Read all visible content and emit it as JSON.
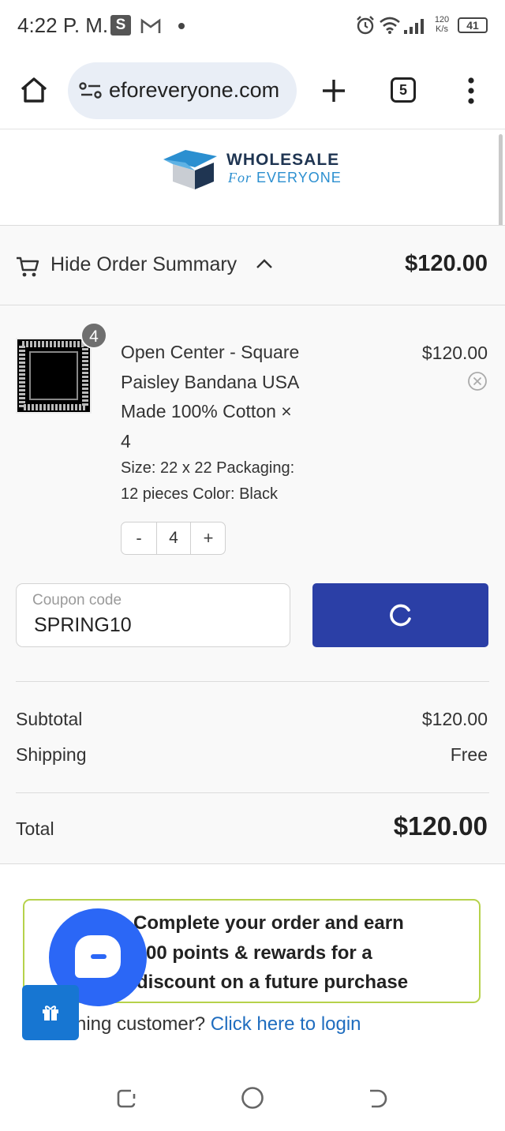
{
  "status_bar": {
    "time": "4:22 P. M.",
    "notif_s": "S",
    "net_speed_top": "120",
    "net_speed_bottom": "K/s",
    "battery": "41"
  },
  "browser": {
    "url": "eforeveryone.com",
    "tab_count": "5"
  },
  "store": {
    "logo_top": "WHOLESALE",
    "logo_bottom_script": "For",
    "logo_bottom": "EVERYONE"
  },
  "summary": {
    "toggle_label": "Hide Order Summary",
    "header_total": "$120.00",
    "item": {
      "badge_qty": "4",
      "name_lines": [
        "Open Center - Square",
        "Paisley Bandana USA",
        "Made 100% Cotton ×",
        "4"
      ],
      "meta_lines": [
        "Size: 22 x 22 Packaging:",
        "12 pieces Color: Black"
      ],
      "price": "$120.00"
    },
    "stepper": {
      "minus": "-",
      "value": "4",
      "plus": "+"
    },
    "coupon": {
      "label": "Coupon code",
      "value": "SPRING10"
    },
    "subtotal_label": "Subtotal",
    "subtotal_value": "$120.00",
    "shipping_label": "Shipping",
    "shipping_value": "Free",
    "total_label": "Total",
    "total_value": "$120.00"
  },
  "rewards": {
    "lines": [
      "Complete your order and earn",
      "00 points & rewards for a",
      "discount on a future purchase"
    ],
    "login_prefix": "ning customer? ",
    "login_link": "Click here to login"
  },
  "colors": {
    "accent_blue": "#2b3fa6",
    "chat_blue": "#2b67f6",
    "gift_blue": "#1776d2",
    "rewards_border": "#b6d24b",
    "link": "#1f6dbf"
  }
}
